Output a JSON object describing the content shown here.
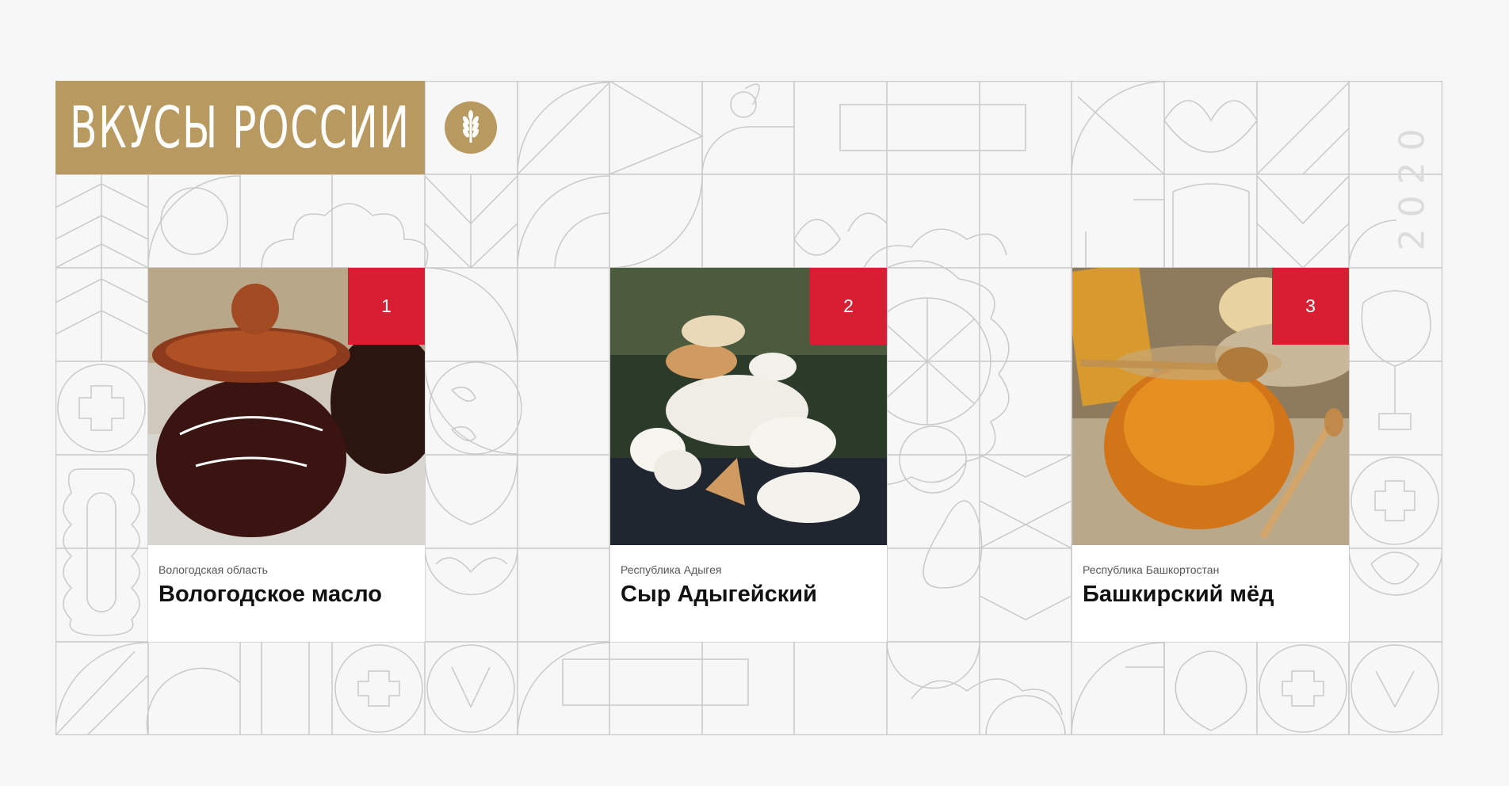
{
  "header": {
    "title": "ВКУСЫ РОССИИ",
    "emblem_icon": "wheat-icon",
    "year": "2020"
  },
  "colors": {
    "brand_gold": "#b8995f",
    "badge_red": "#d81e33",
    "pattern_line": "#c9c9c9",
    "background": "#f6f6f6"
  },
  "cards": [
    {
      "rank": "1",
      "region": "Вологодская область",
      "product": "Вологодское масло",
      "photo": "butter-pot-photo"
    },
    {
      "rank": "2",
      "region": "Республика Адыгея",
      "product": "Сыр Адыгейский",
      "photo": "cheese-photo"
    },
    {
      "rank": "3",
      "region": "Республика Башкортостан",
      "product": "Башкирский мёд",
      "photo": "honey-jar-photo"
    }
  ]
}
